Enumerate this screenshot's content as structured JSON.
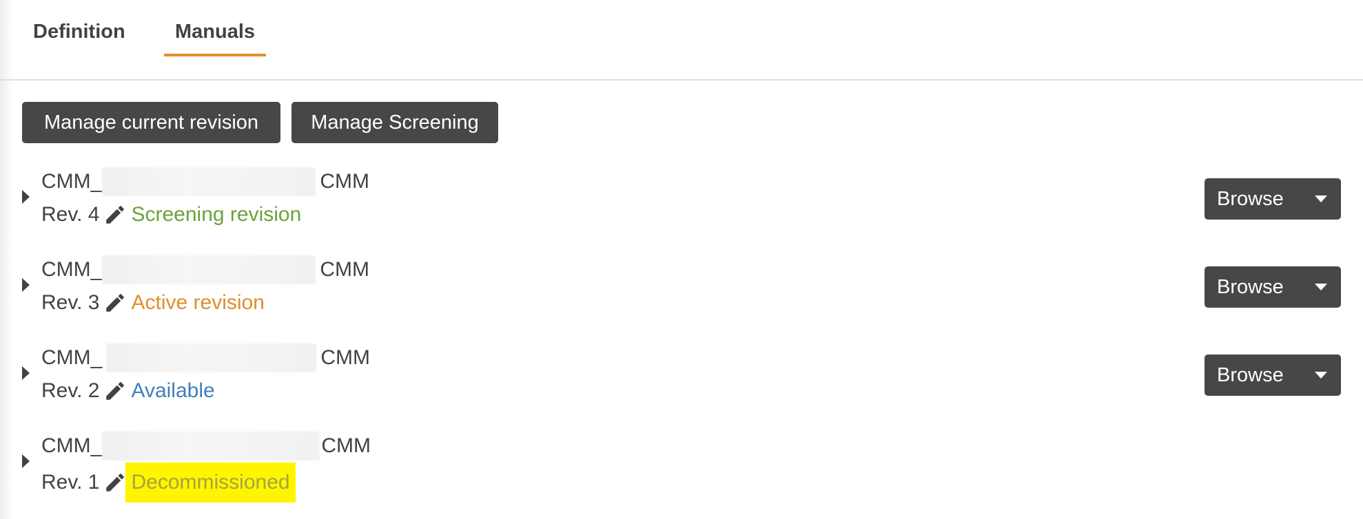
{
  "tabs": [
    {
      "label": "Definition",
      "active": false
    },
    {
      "label": "Manuals",
      "active": true
    }
  ],
  "actions": {
    "manage_current_revision": "Manage current revision",
    "manage_screening": "Manage Screening"
  },
  "colors": {
    "tab_underline": "#e08e2b",
    "button_bg": "#464748",
    "status_screening": "#6aa33a",
    "status_active": "#e08e2b",
    "status_available": "#3f7fba",
    "status_decommissioned": "#a5a43f",
    "highlight_bg": "#fff500"
  },
  "manuals": [
    {
      "name_prefix": "CMM_",
      "name_suffix": "CMM",
      "rev_label": "Rev. 4",
      "status": "Screening revision",
      "browse_label": "Browse"
    },
    {
      "name_prefix": "CMM_",
      "name_suffix": "CMM",
      "rev_label": "Rev. 3",
      "status": "Active revision",
      "browse_label": "Browse"
    },
    {
      "name_prefix": "CMM_",
      "name_suffix": "CMM",
      "rev_label": "Rev. 2",
      "status": "Available",
      "browse_label": "Browse"
    },
    {
      "name_prefix": "CMM_",
      "name_suffix": "CMM",
      "rev_label": "Rev. 1",
      "status": "Decommissioned",
      "browse_label": ""
    }
  ]
}
